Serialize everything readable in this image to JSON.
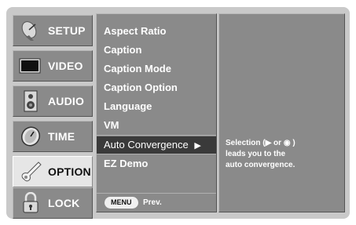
{
  "tabs": [
    {
      "label": "SETUP",
      "icon": "satellite-dish-icon",
      "active": false
    },
    {
      "label": "VIDEO",
      "icon": "monitor-icon",
      "active": false
    },
    {
      "label": "AUDIO",
      "icon": "speaker-icon",
      "active": false
    },
    {
      "label": "TIME",
      "icon": "clock-icon",
      "active": false
    },
    {
      "label": "OPTION",
      "icon": "option-stylus-icon",
      "active": true
    },
    {
      "label": "LOCK",
      "icon": "padlock-icon",
      "active": false
    }
  ],
  "menu": {
    "items": [
      "Aspect Ratio",
      "Caption",
      "Caption Mode",
      "Caption Option",
      "Language",
      "VM",
      "Auto Convergence",
      "EZ Demo"
    ],
    "selected_index": 6,
    "selected_arrow": "▶"
  },
  "footer": {
    "button_label": "MENU",
    "action_label": "Prev."
  },
  "info": {
    "line1_prefix": "Selection (",
    "line1_arrow": "▶",
    "line1_or": " or ",
    "line1_ok": "◉",
    "line1_suffix": " )",
    "line2": "leads you to the",
    "line3": "auto convergence."
  }
}
